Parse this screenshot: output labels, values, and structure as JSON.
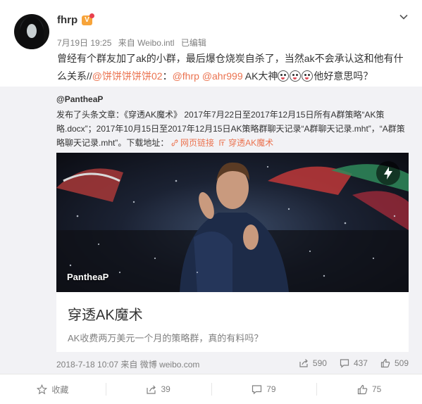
{
  "post": {
    "author": "fhrp",
    "badge_label": "V",
    "meta": {
      "time": "7月19日 19:25",
      "source": "来自 Weibo.intl",
      "edited": "已编辑"
    },
    "text_part1": "曾经有个群友加了ak的小群，最后爆仓烧炭自杀了，当然ak不会承认这和他有什么关系//",
    "mention1": "@饼饼饼饼饼02",
    "text_part2": "：",
    "mention2": "@fhrp",
    "text_part3": " ",
    "mention3": "@ahr999",
    "text_part4": " AK大神",
    "text_part5": "他好意思吗？"
  },
  "repost": {
    "author": "@PantheaP",
    "text_part1": "发布了头条文章：《穿透AK魔术》 2017年7月22日至2017年12月15日所有A群策略“AK策略.docx”；2017年10月15日至2017年12月15日AK策略群聊天记录“A群聊天记录.mht”，“A群策略聊天记录.mht”。下载地址：",
    "link1": "网页链接",
    "link2": "穿透AK魔术",
    "card": {
      "image_caption": "PantheaP",
      "title": "穿透AK魔术",
      "description": "AK收费两万美元一个月的策略群，真的有料吗？"
    },
    "footer": {
      "time_source": "2018-7-18 10:07 来自 微博 weibo.com",
      "reposts": "590",
      "comments": "437",
      "likes": "509"
    }
  },
  "actions": {
    "favorite": "收藏",
    "repost": "39",
    "comment": "79",
    "like": "75"
  },
  "colors": {
    "link": "#eb7350",
    "meta_gray": "#808080",
    "repost_bg": "#f2f2f5",
    "badge": "#f7a43a"
  }
}
